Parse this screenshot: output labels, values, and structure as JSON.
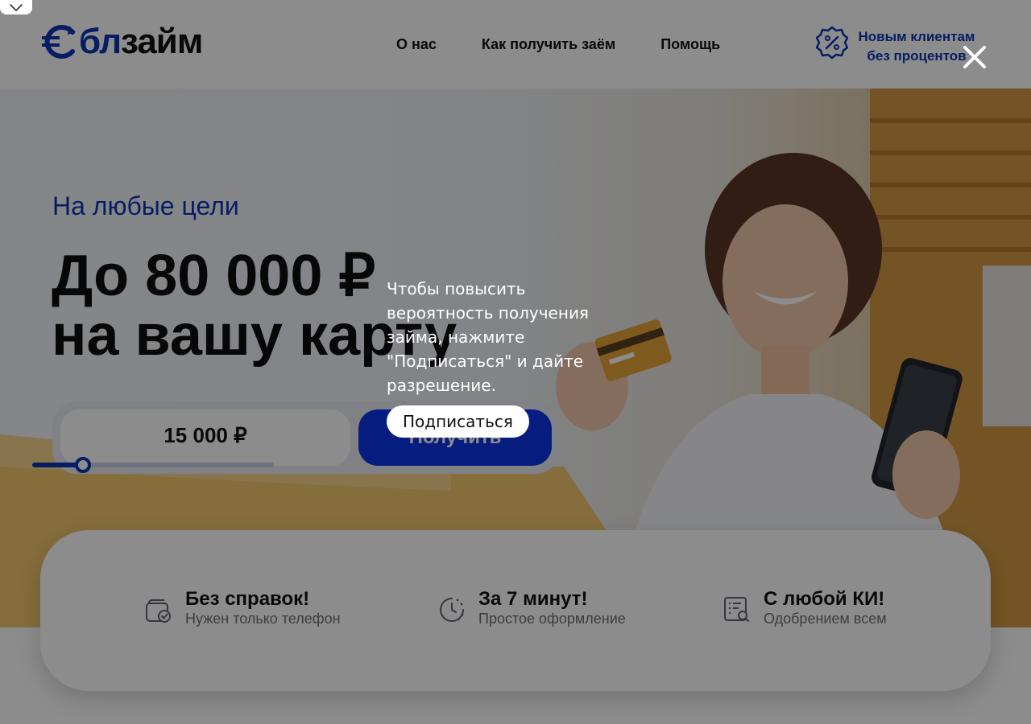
{
  "header": {
    "logo": {
      "part1": "бл",
      "part2": "займ",
      "mark_icon": "euro-cycle-icon"
    },
    "nav": [
      "О нас",
      "Как получить заём",
      "Помощь"
    ],
    "promo": {
      "icon": "percent-badge-icon",
      "line1": "Новым клиентам",
      "line2": "без процентов"
    }
  },
  "hero": {
    "kicker": "На любые цели",
    "headline_line1": "До 80 000 ₽",
    "headline_line2": "на вашу карту",
    "amount": "15 000 ₽",
    "slider_fraction": 0.21,
    "button": "Получить"
  },
  "features": [
    {
      "icon": "wallet-check-icon",
      "title": "Без справок!",
      "subtitle": "Нужен только телефон"
    },
    {
      "icon": "clock-icon",
      "title": "За 7 минут!",
      "subtitle": "Простое оформление"
    },
    {
      "icon": "document-search-icon",
      "title": "С любой КИ!",
      "subtitle": "Одобрением всем"
    }
  ],
  "overlay": {
    "message": "Чтобы повысить вероятность получения займа, нажмите \"Подписаться\" и дайте разрешение.",
    "subscribe_button": "Подписаться",
    "close_icon": "close-icon",
    "collapse_icon": "chevron-down-icon"
  },
  "colors": {
    "brand_blue": "#0b35b4",
    "button_blue": "#0b35e8",
    "text_dark": "#111111",
    "subtext": "#6d6f75"
  }
}
